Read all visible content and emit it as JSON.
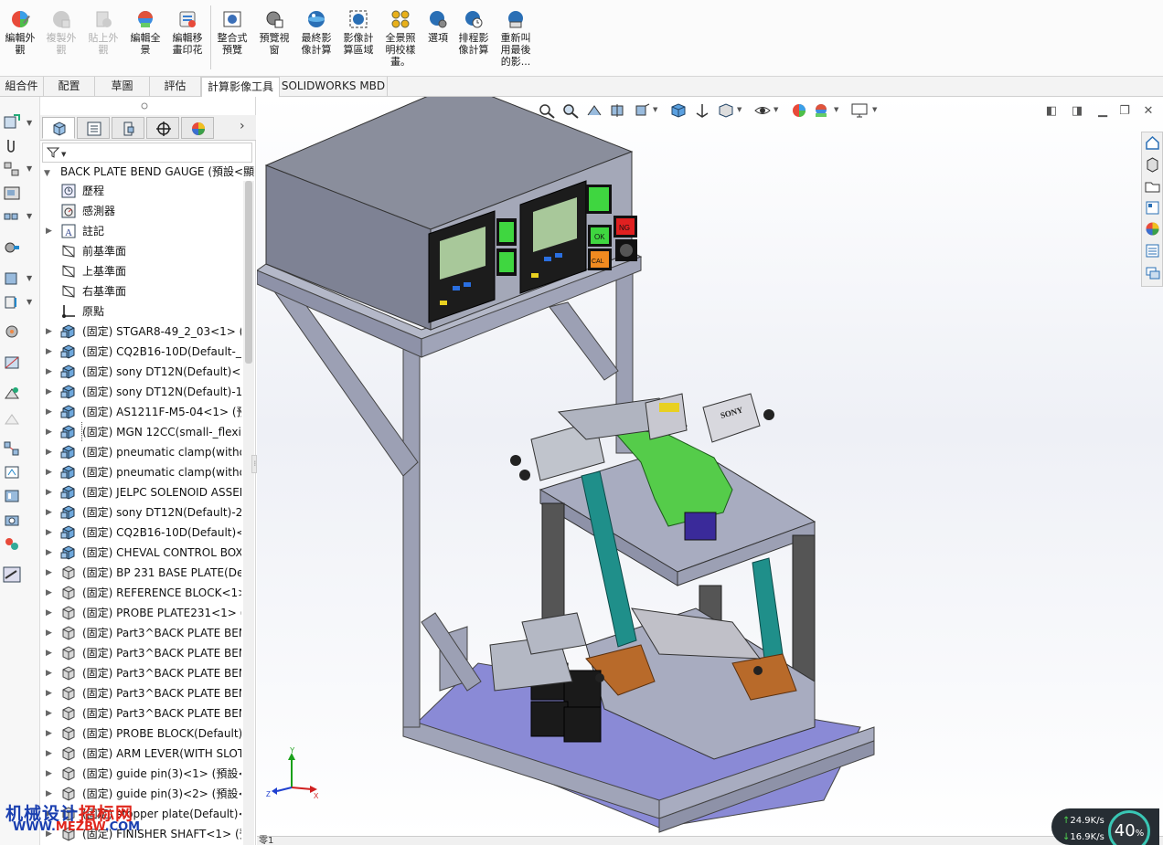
{
  "ribbon": {
    "buttons": [
      {
        "label": "編輯外\n觀",
        "icon": "edit-appearance-icon",
        "enabled": true
      },
      {
        "label": "複製外\n觀",
        "icon": "copy-appearance-icon",
        "enabled": false
      },
      {
        "label": "貼上外\n觀",
        "icon": "paste-appearance-icon",
        "enabled": false
      },
      {
        "label": "編輯全\n景",
        "icon": "edit-scene-icon",
        "enabled": true
      },
      {
        "label": "編輯移\n畫印花",
        "icon": "edit-decal-icon",
        "enabled": true
      },
      {
        "label": "整合式\n預覽",
        "icon": "integrated-preview-icon",
        "enabled": true
      },
      {
        "label": "預覽視\n窗",
        "icon": "preview-window-icon",
        "enabled": true
      },
      {
        "label": "最終影\n像計算",
        "icon": "final-render-icon",
        "enabled": true
      },
      {
        "label": "影像計\n算區域",
        "icon": "render-region-icon",
        "enabled": true
      },
      {
        "label": "全景照\n明校樣\n畫。",
        "icon": "scene-illumination-proof-icon",
        "enabled": true
      },
      {
        "label": "選項",
        "icon": "options-icon",
        "enabled": true
      },
      {
        "label": "排程影\n像計算",
        "icon": "schedule-render-icon",
        "enabled": true
      },
      {
        "label": "重新叫\n用最後\n的影...",
        "icon": "recall-last-render-icon",
        "enabled": true
      }
    ]
  },
  "tabs": [
    {
      "label": "組合件",
      "active": false
    },
    {
      "label": "配置",
      "active": false
    },
    {
      "label": "草圖",
      "active": false
    },
    {
      "label": "評估",
      "active": false
    },
    {
      "label": "計算影像工具",
      "active": true
    },
    {
      "label": "SOLIDWORKS MBD",
      "active": false
    }
  ],
  "tree": {
    "root": "BACK PLATE BEND GAUGE (預設<顯",
    "items": [
      {
        "label": "歷程",
        "icon": "history-icon",
        "expandable": false
      },
      {
        "label": "感測器",
        "icon": "sensor-icon",
        "expandable": false
      },
      {
        "label": "註記",
        "icon": "annotation-icon",
        "expandable": true
      },
      {
        "label": "前基準面",
        "icon": "plane-icon",
        "expandable": false
      },
      {
        "label": "上基準面",
        "icon": "plane-icon",
        "expandable": false
      },
      {
        "label": "右基準面",
        "icon": "plane-icon",
        "expandable": false
      },
      {
        "label": "原點",
        "icon": "origin-icon",
        "expandable": false
      },
      {
        "label": "(固定) STGAR8-49_2_03<1> (預",
        "icon": "subassembly-icon",
        "expandable": true
      },
      {
        "label": "(固定) CQ2B16-10D(Default-_fle",
        "icon": "subassembly-icon",
        "expandable": true
      },
      {
        "label": "(固定) sony DT12N(Default)<1>",
        "icon": "subassembly-icon",
        "expandable": true
      },
      {
        "label": "(固定) sony DT12N(Default)-1<",
        "icon": "subassembly-icon",
        "expandable": true
      },
      {
        "label": "(固定) AS1211F-M5-04<1> (預設",
        "icon": "subassembly-icon",
        "expandable": true
      },
      {
        "label": "(固定) MGN 12CC(small-_flexib",
        "icon": "subassembly-icon",
        "expandable": true,
        "selected": true
      },
      {
        "label": "(固定) pneumatic clamp(withou",
        "icon": "subassembly-icon",
        "expandable": true
      },
      {
        "label": "(固定) pneumatic clamp(withou",
        "icon": "subassembly-icon",
        "expandable": true
      },
      {
        "label": "(固定) JELPC SOLENOID ASSEM",
        "icon": "subassembly-icon",
        "expandable": true
      },
      {
        "label": "(固定) sony DT12N(Default)-2<",
        "icon": "subassembly-icon",
        "expandable": true
      },
      {
        "label": "(固定) CQ2B16-10D(Default)<1",
        "icon": "subassembly-icon",
        "expandable": true
      },
      {
        "label": "(固定) CHEVAL CONTROL BOX",
        "icon": "subassembly-icon",
        "expandable": true
      },
      {
        "label": "(固定) BP 231 BASE PLATE(Defa",
        "icon": "part-icon",
        "expandable": true
      },
      {
        "label": "(固定) REFERENCE BLOCK<1>",
        "icon": "part-icon",
        "expandable": true
      },
      {
        "label": "(固定) PROBE PLATE231<1> (預",
        "icon": "part-icon",
        "expandable": true
      },
      {
        "label": "(固定) Part3^BACK PLATE BEND",
        "icon": "part-icon",
        "expandable": true
      },
      {
        "label": "(固定) Part3^BACK PLATE BEND",
        "icon": "part-icon",
        "expandable": true
      },
      {
        "label": "(固定) Part3^BACK PLATE BEND",
        "icon": "part-icon",
        "expandable": true
      },
      {
        "label": "(固定) Part3^BACK PLATE BEND",
        "icon": "part-icon",
        "expandable": true
      },
      {
        "label": "(固定) Part3^BACK PLATE BEND",
        "icon": "part-icon",
        "expandable": true
      },
      {
        "label": "(固定) PROBE BLOCK(Default)<",
        "icon": "part-icon",
        "expandable": true
      },
      {
        "label": "(固定) ARM LEVER(WITH SLOT",
        "icon": "part-icon",
        "expandable": true
      },
      {
        "label": "(固定) guide pin(3)<1> (預設<",
        "icon": "part-icon",
        "expandable": true
      },
      {
        "label": "(固定) guide pin(3)<2> (預設<",
        "icon": "part-icon",
        "expandable": true
      },
      {
        "label": "(固定) stopper plate(Default)<1",
        "icon": "part-icon",
        "expandable": true
      },
      {
        "label": "(固定) FINISHER SHAFT<1> (預設",
        "icon": "part-icon",
        "expandable": true
      }
    ]
  },
  "model": {
    "control_box_buttons": [
      "OK",
      "NG",
      "CAL"
    ],
    "sensor_brand": "SONY"
  },
  "triad": {
    "x": "X",
    "y": "Y",
    "z": "Z"
  },
  "bottom_tab": "零1",
  "watermark": {
    "line1_part1": "机械设计",
    "line1_part2": "招标网",
    "line2_part1": "WWW.",
    "line2_part2": "MEZBW",
    "line2_part3": ".COM"
  },
  "network": {
    "upload": "24.9K/s",
    "download": "16.9K/s",
    "percent": "40",
    "percent_unit": "%"
  },
  "colors": {
    "accent": "#39c6b4",
    "frame": "#9ca0b4",
    "box": "#8e92a8",
    "arm": "#1f8f8a",
    "bracket_green": "#55cc4a",
    "bracket_orange": "#b86a2a",
    "base": "#8a8ad6"
  }
}
